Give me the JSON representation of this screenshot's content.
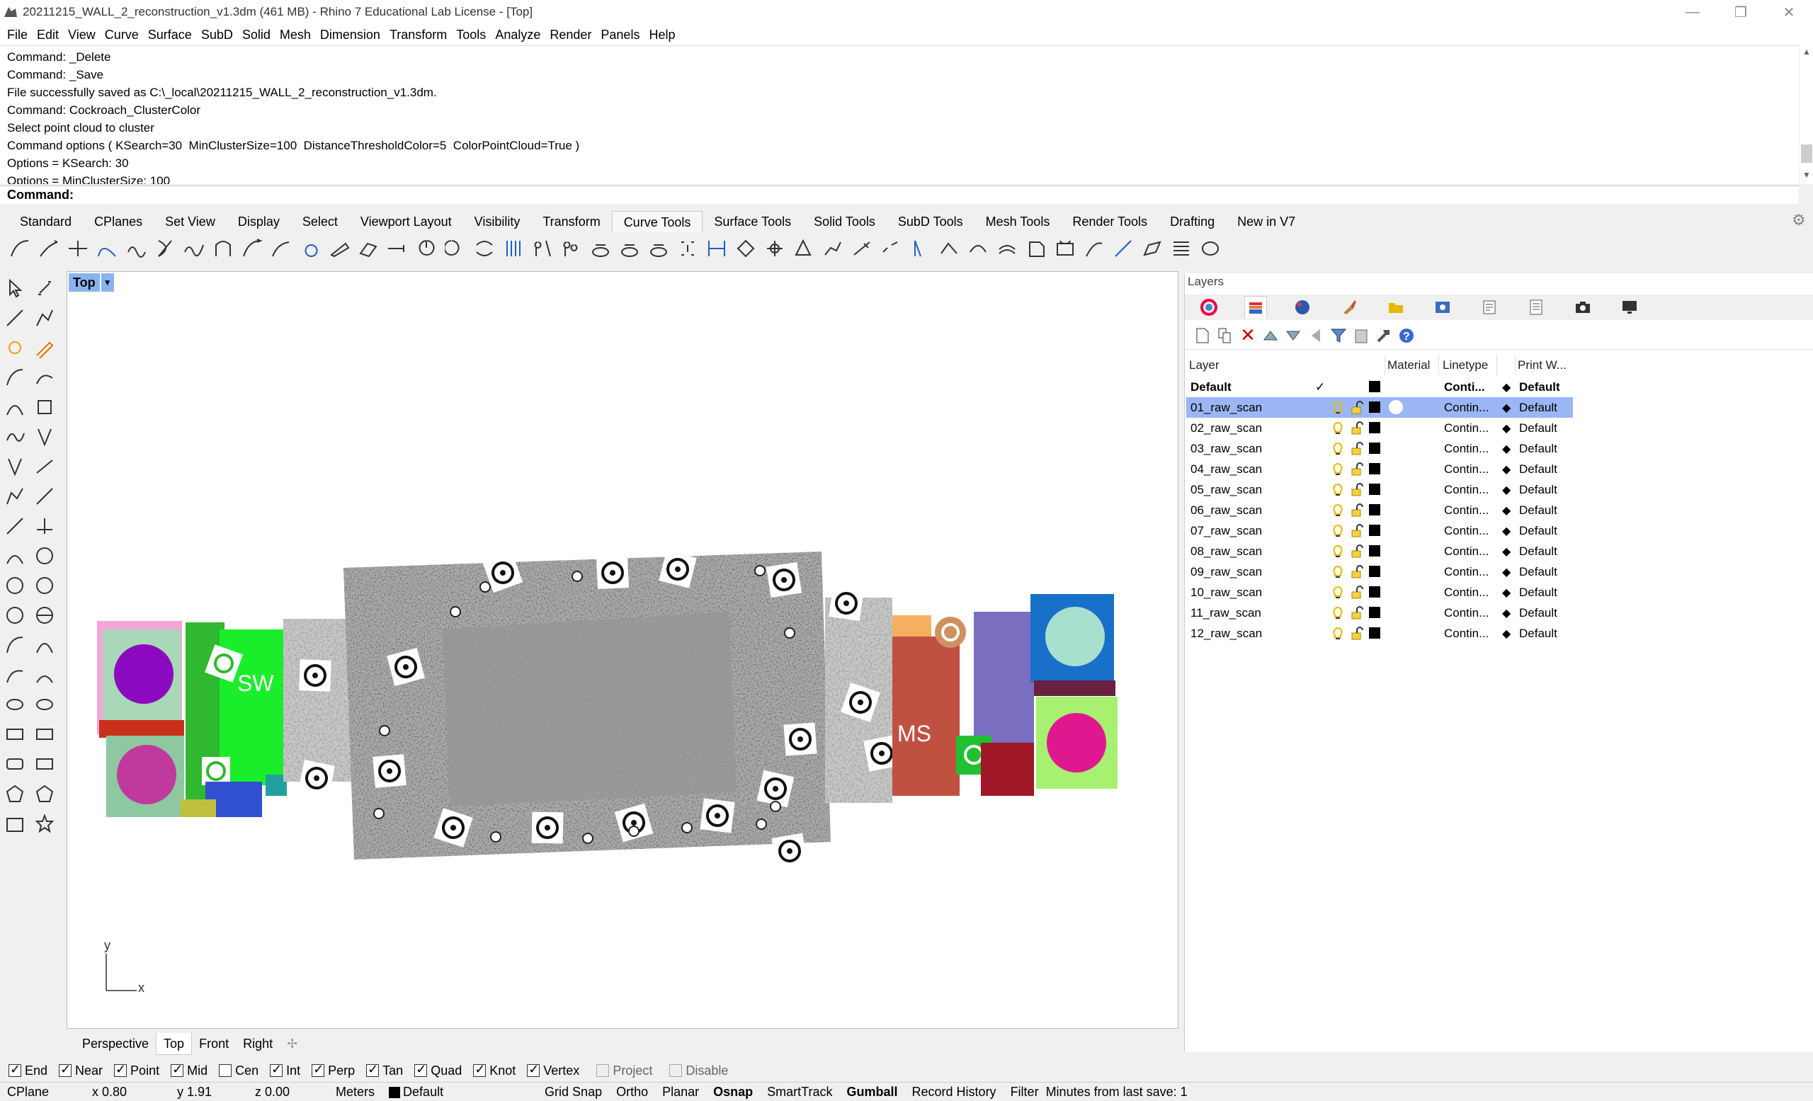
{
  "window": {
    "title": "20211215_WALL_2_reconstruction_v1.3dm (461 MB) - Rhino 7 Educational Lab License - [Top]"
  },
  "menu": [
    "File",
    "Edit",
    "View",
    "Curve",
    "Surface",
    "SubD",
    "Solid",
    "Mesh",
    "Dimension",
    "Transform",
    "Tools",
    "Analyze",
    "Render",
    "Panels",
    "Help"
  ],
  "command_history": [
    "Command: _Delete",
    "Command: _Save",
    "File successfully saved as C:\\_local\\20211215_WALL_2_reconstruction_v1.3dm.",
    "Command: Cockroach_ClusterColor",
    "Select point cloud to cluster",
    "Command options ( KSearch=30  MinClusterSize=100  DistanceThresholdColor=5  ColorPointCloud=True )",
    "Options = KSearch: 30",
    "Options = MinClusterSize: 100"
  ],
  "command_prompt": "Command:",
  "toolbar_tabs": [
    "Standard",
    "CPlanes",
    "Set View",
    "Display",
    "Select",
    "Viewport Layout",
    "Visibility",
    "Transform",
    "Curve Tools",
    "Surface Tools",
    "Solid Tools",
    "SubD Tools",
    "Mesh Tools",
    "Render Tools",
    "Drafting",
    "New in V7"
  ],
  "active_toolbar_tab": "Curve Tools",
  "viewport": {
    "name": "Top",
    "axis_x": "x",
    "axis_y": "y",
    "marker_texts": [
      "SW",
      "MS"
    ]
  },
  "viewport_tabs": [
    "Perspective",
    "Top",
    "Front",
    "Right"
  ],
  "active_viewport_tab": "Top",
  "osnaps": [
    {
      "label": "End",
      "checked": true
    },
    {
      "label": "Near",
      "checked": true
    },
    {
      "label": "Point",
      "checked": true
    },
    {
      "label": "Mid",
      "checked": true
    },
    {
      "label": "Cen",
      "checked": false
    },
    {
      "label": "Int",
      "checked": true
    },
    {
      "label": "Perp",
      "checked": true
    },
    {
      "label": "Tan",
      "checked": true
    },
    {
      "label": "Quad",
      "checked": true
    },
    {
      "label": "Knot",
      "checked": true
    },
    {
      "label": "Vertex",
      "checked": true
    },
    {
      "label": "Project",
      "checked": false,
      "disabled": true
    },
    {
      "label": "Disable",
      "checked": false,
      "disabled": true
    }
  ],
  "status": {
    "cplane": "CPlane",
    "x": "x 0.80",
    "y": "y 1.91",
    "z": "z 0.00",
    "units": "Meters",
    "layer": "Default",
    "grid_snap": "Grid Snap",
    "ortho": "Ortho",
    "planar": "Planar",
    "osnap": "Osnap",
    "smarttrack": "SmartTrack",
    "gumball": "Gumball",
    "record_history": "Record History",
    "filter": "Filter",
    "save_info": "Minutes from last save: 1"
  },
  "layers_panel": {
    "title": "Layers",
    "columns": {
      "layer": "Layer",
      "material": "Material",
      "linetype": "Linetype",
      "print_width": "Print W..."
    },
    "rows": [
      {
        "name": "Default",
        "current": true,
        "linetype": "Conti...",
        "print": "Default",
        "bold": true
      },
      {
        "name": "01_raw_scan",
        "linetype": "Contin...",
        "print": "Default",
        "selected": true
      },
      {
        "name": "02_raw_scan",
        "linetype": "Contin...",
        "print": "Default"
      },
      {
        "name": "03_raw_scan",
        "linetype": "Contin...",
        "print": "Default"
      },
      {
        "name": "04_raw_scan",
        "linetype": "Contin...",
        "print": "Default"
      },
      {
        "name": "05_raw_scan",
        "linetype": "Contin...",
        "print": "Default"
      },
      {
        "name": "06_raw_scan",
        "linetype": "Contin...",
        "print": "Default"
      },
      {
        "name": "07_raw_scan",
        "linetype": "Contin...",
        "print": "Default"
      },
      {
        "name": "08_raw_scan",
        "linetype": "Contin...",
        "print": "Default"
      },
      {
        "name": "09_raw_scan",
        "linetype": "Contin...",
        "print": "Default"
      },
      {
        "name": "10_raw_scan",
        "linetype": "Contin...",
        "print": "Default"
      },
      {
        "name": "11_raw_scan",
        "linetype": "Contin...",
        "print": "Default"
      },
      {
        "name": "12_raw_scan",
        "linetype": "Contin...",
        "print": "Default"
      }
    ]
  },
  "colors": {
    "selection": "#9bb6f5",
    "viewport_label": "#8ab4f0",
    "bulb": "#e8b800",
    "delete": "#d00000"
  }
}
